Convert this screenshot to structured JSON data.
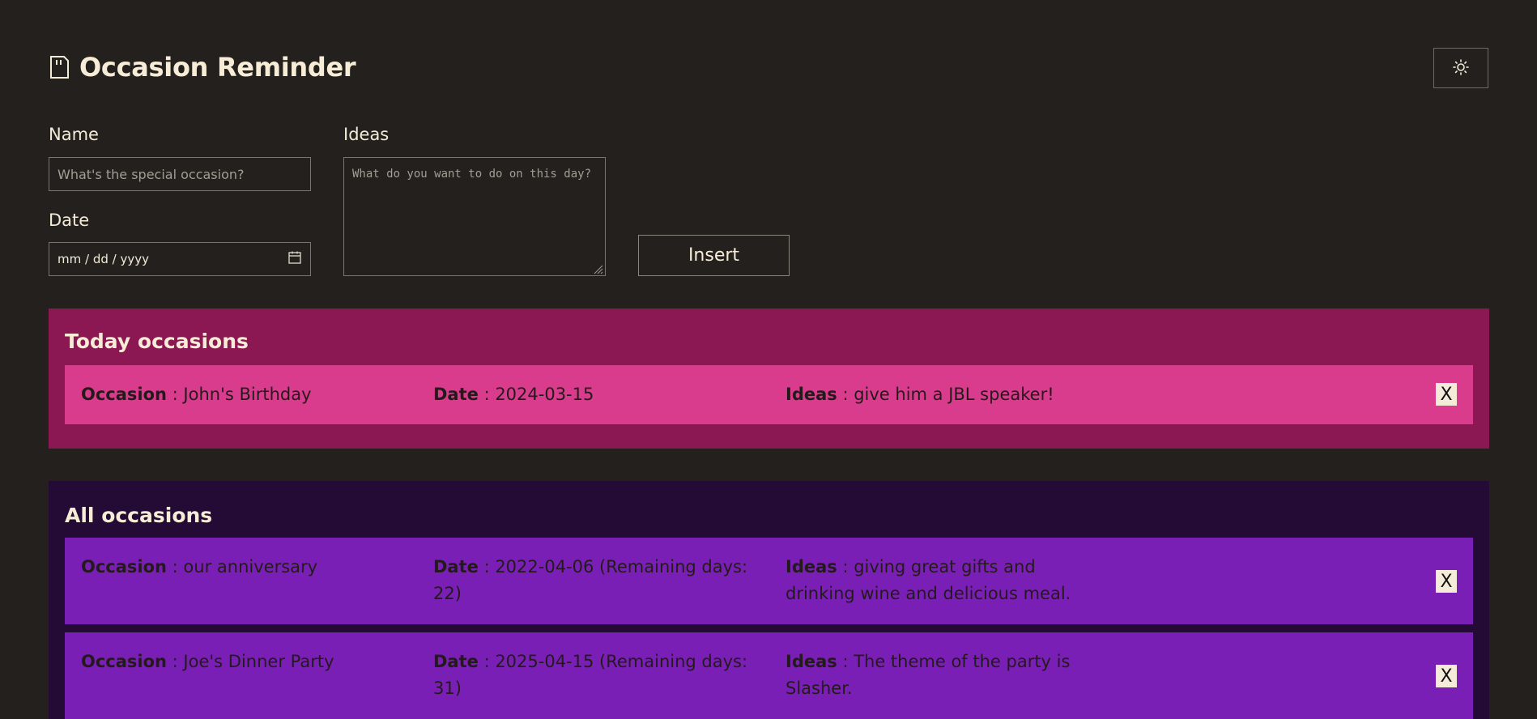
{
  "app": {
    "title": "Occasion Reminder"
  },
  "form": {
    "name_label": "Name",
    "name_placeholder": "What's the special occasion?",
    "date_label": "Date",
    "date_placeholder": "mm / dd / yyyy",
    "ideas_label": "Ideas",
    "ideas_placeholder": "What do you want to do on this day?",
    "insert_label": "Insert"
  },
  "today": {
    "title": "Today occasions",
    "items": [
      {
        "occasion_key": "Occasion",
        "occasion": " : John's Birthday",
        "date_key": "Date",
        "date": " : 2024-03-15",
        "ideas_key": "Ideas",
        "ideas": " : give him a JBL speaker!",
        "delete_label": "X"
      }
    ]
  },
  "all": {
    "title": "All occasions",
    "items": [
      {
        "occasion_key": "Occasion",
        "occasion": " : our anniversary",
        "date_key": "Date",
        "date": " : 2022-04-06 (Remaining days: 22)",
        "ideas_key": "Ideas",
        "ideas": " : giving great gifts and drinking wine and delicious meal.",
        "delete_label": "X"
      },
      {
        "occasion_key": "Occasion",
        "occasion": " : Joe's Dinner Party",
        "date_key": "Date",
        "date": " : 2025-04-15 (Remaining days: 31)",
        "ideas_key": "Ideas",
        "ideas": " : The theme of the party is Slasher.",
        "delete_label": "X"
      }
    ]
  },
  "icons": {
    "title_icon": "document-icon",
    "theme_icon": "sun-icon",
    "calendar_icon": "calendar-icon"
  },
  "colors": {
    "background": "#23201e",
    "today_section": "#8b1753",
    "today_card": "#da3c8d",
    "all_section": "#240b35",
    "all_card": "#7a1fb6"
  }
}
